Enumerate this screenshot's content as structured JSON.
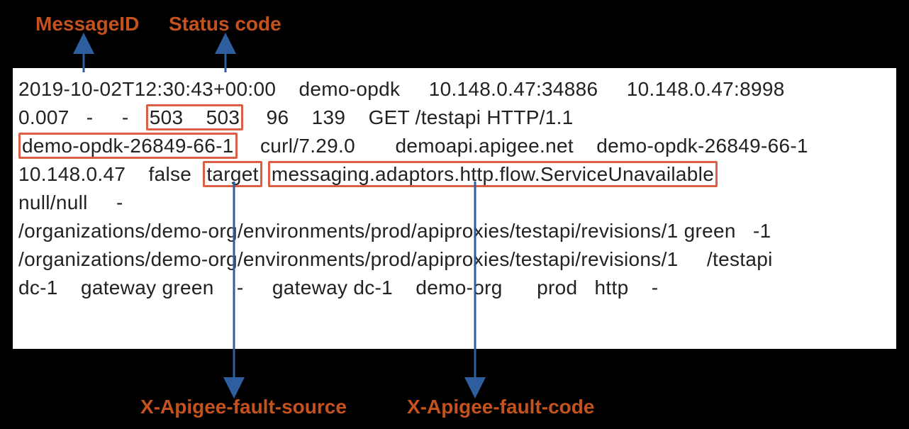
{
  "labels": {
    "messageId": "MessageID",
    "statusCode": "Status code",
    "faultSource": "X-Apigee-fault-source",
    "faultCode": "X-Apigee-fault-code"
  },
  "log": {
    "line1": {
      "a": "2019-10-02T12:30:43+00:00    demo-opdk     10.148.0.47:34886     10.148.0.47:8998"
    },
    "line2": {
      "a": "0.007   -     -   ",
      "statusGroup": "503    503",
      "b": "    96    139    GET /testapi HTTP/1.1"
    },
    "line3": {
      "msgId": "demo-opdk-26849-66-1",
      "b": "    curl/7.29.0       demoapi.apigee.net    demo-opdk-26849-66-1"
    },
    "line4": {
      "a": "10.148.0.47    false  ",
      "target": "target",
      "gap": " ",
      "fcode": "messaging.adaptors.http.flow.ServiceUnavailable"
    },
    "line5": {
      "a": "null/null     -"
    },
    "line6": {
      "a": "/organizations/demo-org/environments/prod/apiproxies/testapi/revisions/1 green   -1"
    },
    "line7": {
      "a": "/organizations/demo-org/environments/prod/apiproxies/testapi/revisions/1     /testapi"
    },
    "line8": {
      "a": "dc-1    gateway green    -     gateway dc-1    demo-org      prod   http    -"
    }
  }
}
